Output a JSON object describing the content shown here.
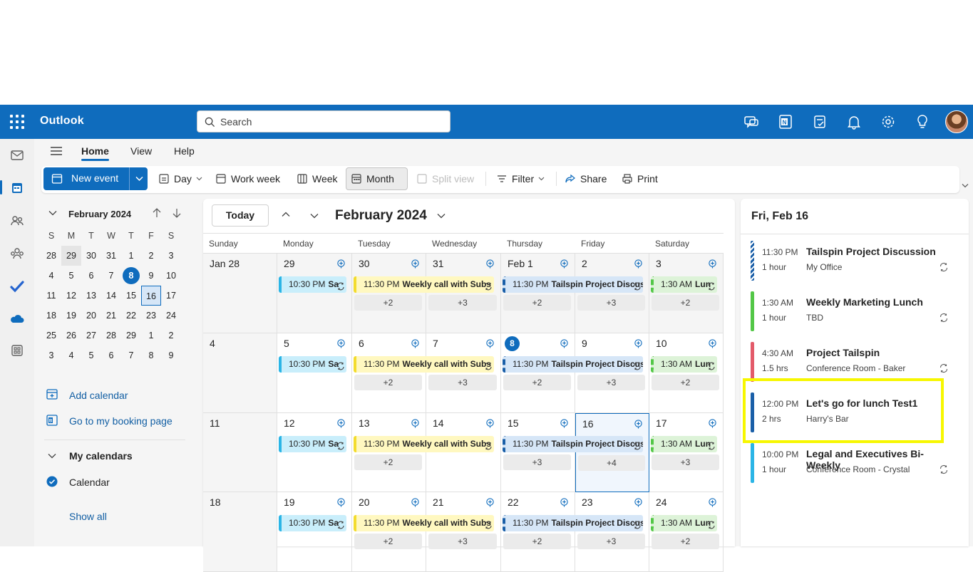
{
  "app": {
    "name": "Outlook"
  },
  "search": {
    "placeholder": "Search"
  },
  "ribbon_tabs": [
    "Home",
    "View",
    "Help"
  ],
  "ribbon": {
    "new_event": "New event",
    "day": "Day",
    "work_week": "Work week",
    "week": "Week",
    "month": "Month",
    "split_view": "Split view",
    "filter": "Filter",
    "share": "Share",
    "print": "Print"
  },
  "mini_calendar": {
    "title": "February 2024",
    "dow": [
      "S",
      "M",
      "T",
      "W",
      "T",
      "F",
      "S"
    ],
    "weeks": [
      [
        "28",
        "29",
        "30",
        "31",
        "1",
        "2",
        "3"
      ],
      [
        "4",
        "5",
        "6",
        "7",
        "8",
        "9",
        "10"
      ],
      [
        "11",
        "12",
        "13",
        "14",
        "15",
        "16",
        "17"
      ],
      [
        "18",
        "19",
        "20",
        "21",
        "22",
        "23",
        "24"
      ],
      [
        "25",
        "26",
        "27",
        "28",
        "29",
        "1",
        "2"
      ],
      [
        "3",
        "4",
        "5",
        "6",
        "7",
        "8",
        "9"
      ]
    ]
  },
  "left_links": {
    "add_calendar": "Add calendar",
    "booking": "Go to my booking page",
    "my_calendars": "My calendars",
    "calendar": "Calendar",
    "show_all": "Show all"
  },
  "month_view": {
    "today": "Today",
    "title": "February 2024",
    "dow": [
      "Sunday",
      "Monday",
      "Tuesday",
      "Wednesday",
      "Thursday",
      "Friday",
      "Saturday"
    ],
    "weeks": [
      {
        "days": [
          "Jan 28",
          "29",
          "30",
          "31",
          "Feb 1",
          "2",
          "3"
        ],
        "more": [
          "",
          "",
          "+2",
          "+3",
          "+2",
          "+3",
          "+2"
        ]
      },
      {
        "days": [
          "4",
          "5",
          "6",
          "7",
          "8",
          "9",
          "10"
        ],
        "more": [
          "",
          "",
          "+2",
          "+3",
          "+2",
          "+3",
          "+2"
        ]
      },
      {
        "days": [
          "11",
          "12",
          "13",
          "14",
          "15",
          "16",
          "17"
        ],
        "more": [
          "",
          "",
          "+2",
          "",
          "+3",
          "+4",
          "+3"
        ]
      },
      {
        "days": [
          "18",
          "19",
          "20",
          "21",
          "22",
          "23",
          "24"
        ],
        "more": [
          "",
          "",
          "+2",
          "+3",
          "+2",
          "+3",
          "+2"
        ]
      }
    ],
    "events": {
      "monday": {
        "time": "10:30 PM",
        "title": "Sa"
      },
      "tue_wed": {
        "time": "11:30 PM",
        "title": "Weekly call with Subs"
      },
      "thu_fri": {
        "time": "11:30 PM",
        "title": "Tailspin Project Discus"
      },
      "saturday": {
        "time": "1:30 AM",
        "title": "Lun"
      }
    }
  },
  "agenda": {
    "title": "Fri, Feb 16",
    "items": [
      {
        "time": "11:30 PM",
        "duration": "1 hour",
        "title": "Tailspin Project Discussion",
        "location": "My Office",
        "color": "#1a5fa8"
      },
      {
        "time": "1:30 AM",
        "duration": "1 hour",
        "title": "Weekly Marketing Lunch",
        "location": "TBD",
        "color": "#53c747"
      },
      {
        "time": "4:30 AM",
        "duration": "1.5 hrs",
        "title": "Project Tailspin",
        "location": "Conference Room - Baker",
        "color": "#e35b6a"
      },
      {
        "time": "12:00 PM",
        "duration": "2 hrs",
        "title": "Let's go for lunch Test1",
        "location": "Harry's Bar",
        "color": "#1a5fa8"
      },
      {
        "time": "10:00 PM",
        "duration": "1 hour",
        "title": "Legal and Executives Bi-Weekly",
        "location": "Conference Room - Crystal",
        "color": "#2bb5e6"
      }
    ]
  }
}
